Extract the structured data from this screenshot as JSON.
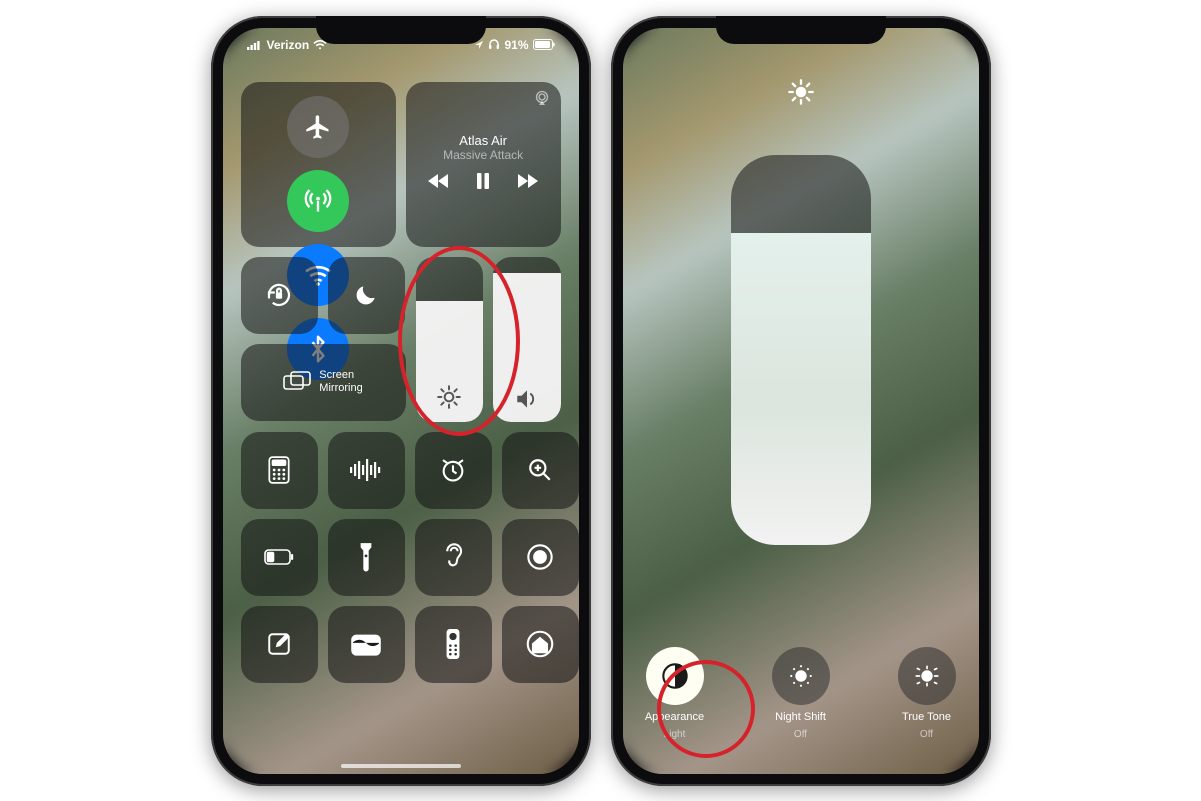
{
  "status": {
    "carrier": "Verizon",
    "battery": "91%"
  },
  "music": {
    "track": "Atlas Air",
    "artist": "Massive Attack"
  },
  "screen_mirroring_label": "Screen\nMirroring",
  "brightness_percent": 73,
  "volume_percent": 90,
  "large_brightness_percent": 80,
  "options": {
    "appearance": {
      "title": "Appearance",
      "status": "Light"
    },
    "night_shift": {
      "title": "Night Shift",
      "status": "Off"
    },
    "true_tone": {
      "title": "True Tone",
      "status": "Off"
    }
  }
}
